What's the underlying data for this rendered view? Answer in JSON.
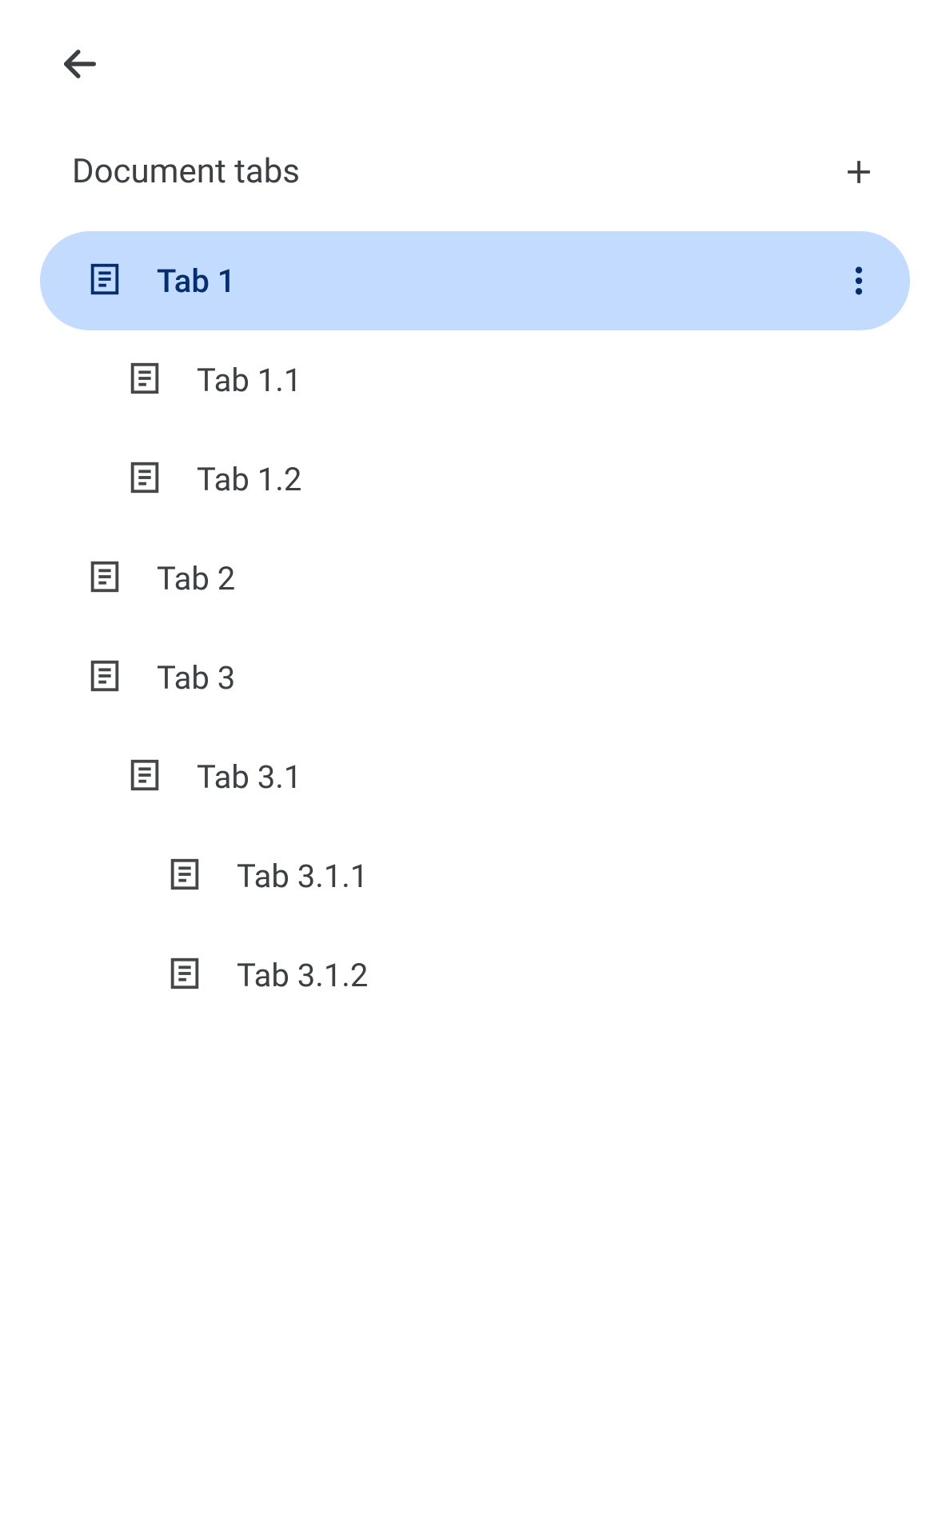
{
  "header": {
    "title": "Document tabs"
  },
  "tabs": [
    {
      "label": "Tab 1",
      "level": 0,
      "selected": true,
      "showMore": true
    },
    {
      "label": "Tab 1.1",
      "level": 1,
      "selected": false,
      "showMore": false
    },
    {
      "label": "Tab 1.2",
      "level": 1,
      "selected": false,
      "showMore": false
    },
    {
      "label": "Tab 2",
      "level": 0,
      "selected": false,
      "showMore": false
    },
    {
      "label": "Tab 3",
      "level": 0,
      "selected": false,
      "showMore": false
    },
    {
      "label": "Tab 3.1",
      "level": 1,
      "selected": false,
      "showMore": false
    },
    {
      "label": "Tab 3.1.1",
      "level": 2,
      "selected": false,
      "showMore": false
    },
    {
      "label": "Tab 3.1.2",
      "level": 2,
      "selected": false,
      "showMore": false
    }
  ],
  "colors": {
    "selectedBg": "#c2dbff",
    "selectedText": "#062e6f",
    "text": "#3c4043",
    "iconDefault": "#444746",
    "iconSelected": "#062e6f"
  }
}
